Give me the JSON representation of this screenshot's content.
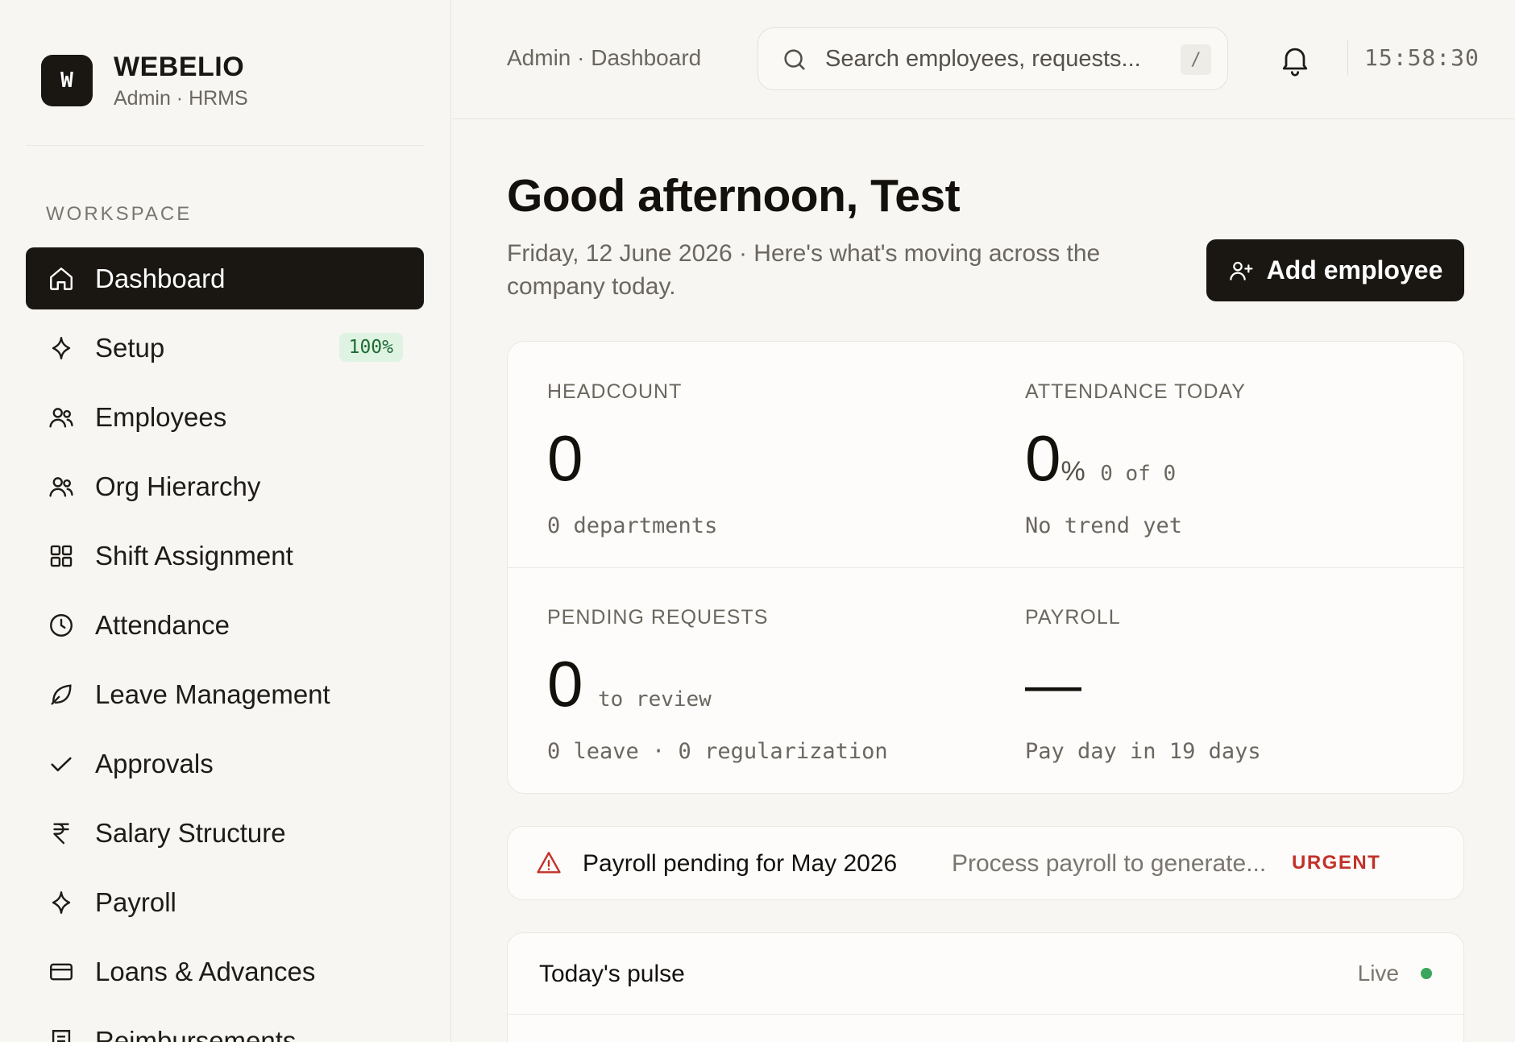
{
  "brand": {
    "logo_letter": "W",
    "name": "WEBELIO",
    "subtitle": "Admin · HRMS"
  },
  "sidebar": {
    "section_label": "WORKSPACE",
    "items": [
      {
        "label": "Dashboard",
        "icon": "home-icon",
        "active": true
      },
      {
        "label": "Setup",
        "icon": "sparkle-icon",
        "badge": "100%"
      },
      {
        "label": "Employees",
        "icon": "users-icon"
      },
      {
        "label": "Org Hierarchy",
        "icon": "users-icon"
      },
      {
        "label": "Shift Assignment",
        "icon": "grid-icon"
      },
      {
        "label": "Attendance",
        "icon": "clock-icon"
      },
      {
        "label": "Leave Management",
        "icon": "leaf-icon"
      },
      {
        "label": "Approvals",
        "icon": "check-icon"
      },
      {
        "label": "Salary Structure",
        "icon": "rupee-icon"
      },
      {
        "label": "Payroll",
        "icon": "sparkle-icon"
      },
      {
        "label": "Loans & Advances",
        "icon": "card-icon"
      },
      {
        "label": "Reimbursements",
        "icon": "receipt-icon"
      }
    ]
  },
  "topbar": {
    "breadcrumb": "Admin · Dashboard",
    "search_placeholder": "Search employees, requests...",
    "search_shortcut": "/",
    "clock": "15:58:30"
  },
  "main": {
    "greeting": "Good afternoon, Test",
    "subtitle": "Friday, 12 June 2026 · Here's what's moving across the company today.",
    "add_button_label": "Add employee"
  },
  "stats": {
    "headcount": {
      "label": "HEADCOUNT",
      "value": "0",
      "foot": "0 departments"
    },
    "attendance": {
      "label": "ATTENDANCE TODAY",
      "value": "0",
      "unit": "%",
      "inline": "0 of 0",
      "foot": "No trend yet"
    },
    "pending": {
      "label": "PENDING REQUESTS",
      "value": "0",
      "inline": "to review",
      "foot": "0 leave · 0 regularization"
    },
    "payroll": {
      "label": "PAYROLL",
      "value": "—",
      "foot": "Pay day in 19 days"
    }
  },
  "alert": {
    "title": "Payroll pending for May 2026",
    "description": "Process payroll to generate...",
    "badge": "URGENT",
    "badge_color": "#c2322a"
  },
  "pulse": {
    "title": "Today's pulse",
    "status": "Live",
    "status_color": "#3aa55d"
  },
  "colors": {
    "primary": "#1a1713",
    "background": "#f7f6f2",
    "badge_bg": "#dff3e3",
    "badge_text": "#1d6b33"
  }
}
